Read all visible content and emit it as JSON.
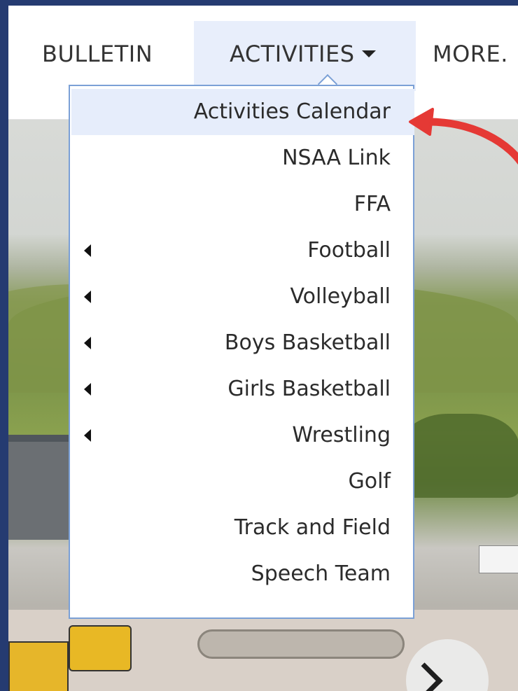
{
  "nav": {
    "bulletin": "BULLETIN",
    "activities": "ACTIVITIES",
    "more": "MORE."
  },
  "dropdown": {
    "items": [
      {
        "label": "Activities Calendar",
        "has_submenu": false,
        "active": true
      },
      {
        "label": "NSAA Link",
        "has_submenu": false
      },
      {
        "label": "FFA",
        "has_submenu": false
      },
      {
        "label": "Football",
        "has_submenu": true
      },
      {
        "label": "Volleyball",
        "has_submenu": true
      },
      {
        "label": "Boys Basketball",
        "has_submenu": true
      },
      {
        "label": "Girls Basketball",
        "has_submenu": true
      },
      {
        "label": "Wrestling",
        "has_submenu": true
      },
      {
        "label": "Golf",
        "has_submenu": false
      },
      {
        "label": "Track and Field",
        "has_submenu": false
      },
      {
        "label": "Speech Team",
        "has_submenu": false
      }
    ]
  },
  "colors": {
    "frame_border": "#253b71",
    "active_bg": "#e8eefb",
    "menu_border": "#7ba0d6",
    "annotation_arrow": "#e53935"
  },
  "icons": {
    "caret": "caret-down-icon",
    "submenu": "caret-left-icon",
    "carousel_next": "chevron-right-icon",
    "annotation": "red-arrow"
  }
}
